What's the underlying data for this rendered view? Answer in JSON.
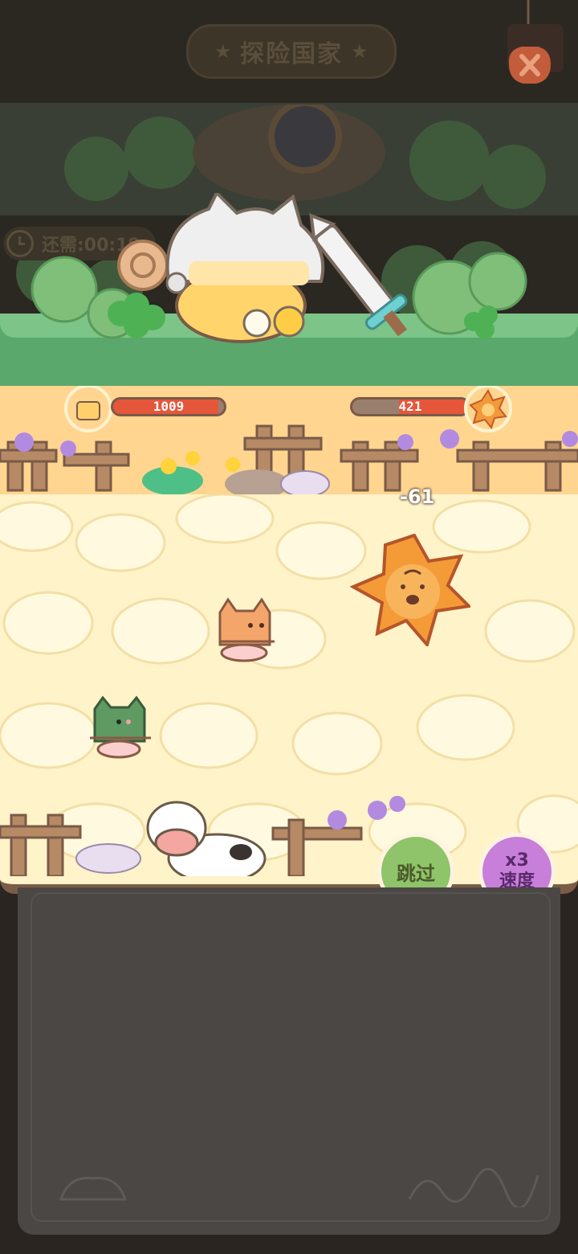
{
  "header": {
    "title": "探险国家",
    "close_icon": "close-x-icon"
  },
  "timer": {
    "label": "还需:00:19"
  },
  "battle": {
    "player_hp": "1009",
    "player_hp_fraction": 0.95,
    "enemy_hp": "421",
    "enemy_hp_fraction": 0.6,
    "damage_popup": "-61"
  },
  "controls": {
    "skip_label": "跳过",
    "speed_multiplier": "x3",
    "speed_label": "速度"
  },
  "colors": {
    "arena_floor": "#fff3c9",
    "hp_fill": "#e6563a",
    "skip_button": "#8fc46a",
    "speed_button": "#c77fd9"
  }
}
